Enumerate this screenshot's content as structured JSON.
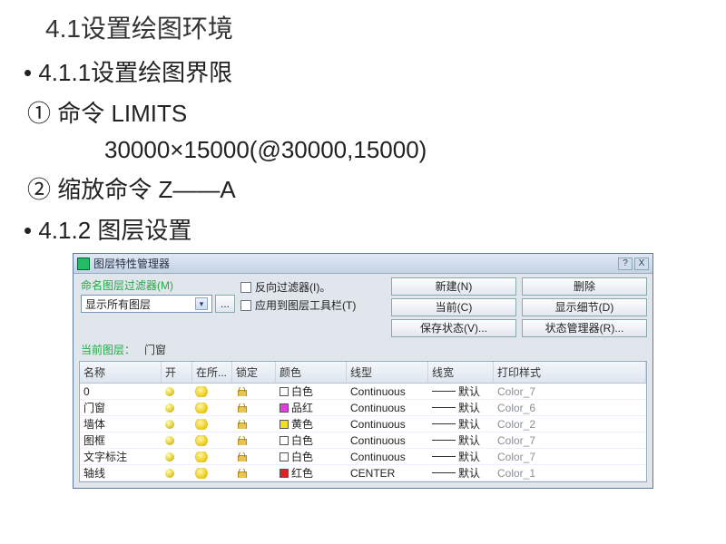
{
  "doc": {
    "heading": "4.1设置绘图环境",
    "l1": "4.1.1设置绘图界限",
    "l2": "① 命令 LIMITS",
    "l3": "30000×15000(@30000,15000)",
    "l4": "② 缩放命令 Z——A",
    "l5": "4.1.2 图层设置"
  },
  "dialog": {
    "title": "图层特性管理器",
    "help_btn": "?",
    "close_btn": "X",
    "named_filter_label": "命名图层过滤器(M)",
    "filter_value": "显示所有图层",
    "dots": "...",
    "chk_invert": "反向过滤器(I)。",
    "chk_apply": "应用到图层工具栏(T)",
    "btn_new": "新建(N)",
    "btn_delete": "删除",
    "btn_current": "当前(C)",
    "btn_detail": "显示细节(D)",
    "btn_save": "保存状态(V)...",
    "btn_mgr": "状态管理器(R)...",
    "cur_label": "当前图层：",
    "cur_value": "门窗",
    "head": {
      "name": "名称",
      "on": "开",
      "freeze": "在所...",
      "lock": "锁定",
      "color": "颜色",
      "ltype": "线型",
      "lweight": "线宽",
      "pstyle": "打印样式"
    },
    "rows": [
      {
        "name": "0",
        "color_hex": "#ffffff",
        "color": "白色",
        "ltype": "Continuous",
        "lw": "默认",
        "ps": "Color_7"
      },
      {
        "name": "门窗",
        "color_hex": "#e040e0",
        "color": "品红",
        "ltype": "Continuous",
        "lw": "默认",
        "ps": "Color_6"
      },
      {
        "name": "墙体",
        "color_hex": "#f0e020",
        "color": "黄色",
        "ltype": "Continuous",
        "lw": "默认",
        "ps": "Color_2"
      },
      {
        "name": "图框",
        "color_hex": "#ffffff",
        "color": "白色",
        "ltype": "Continuous",
        "lw": "默认",
        "ps": "Color_7"
      },
      {
        "name": "文字标注",
        "color_hex": "#ffffff",
        "color": "白色",
        "ltype": "Continuous",
        "lw": "默认",
        "ps": "Color_7"
      },
      {
        "name": "轴线",
        "color_hex": "#e02020",
        "color": "红色",
        "ltype": "CENTER",
        "lw": "默认",
        "ps": "Color_1"
      }
    ]
  }
}
